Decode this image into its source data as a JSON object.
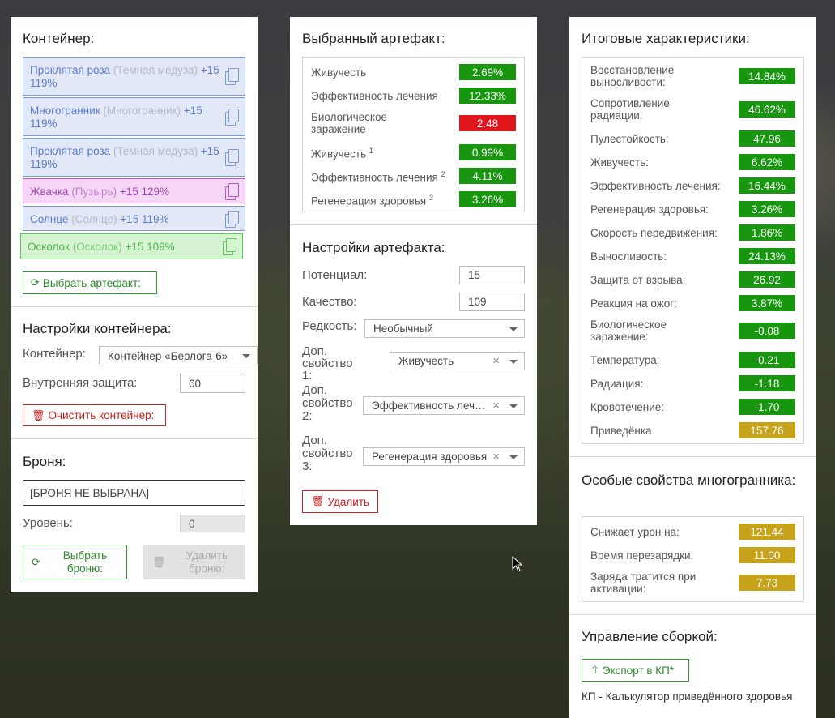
{
  "container": {
    "heading": "Контейнер:",
    "items": [
      {
        "name": "Проклятая роза",
        "sub": "(Темная медуза)",
        "level": "+15 119%"
      },
      {
        "name": "Многогранник",
        "sub": "(Многогранник)",
        "level": "+15 119%"
      },
      {
        "name": "Проклятая роза",
        "sub": "(Темная медуза)",
        "level": "+15 119%"
      },
      {
        "name": "Жвачка",
        "sub": "(Пузырь)",
        "level": "+15 129%"
      },
      {
        "name": "Солнце",
        "sub": "(Солнце)",
        "level": "+15 119%"
      },
      {
        "name": "Осколок",
        "sub": "(Осколок)",
        "level": "+15 109%"
      }
    ],
    "select_button": "Выбрать артефакт:"
  },
  "container_settings": {
    "heading": "Настройки контейнера:",
    "container_label": "Контейнер:",
    "container_value": "Контейнер «Берлога-6»",
    "protection_label": "Внутренняя защита:",
    "protection_value": "60",
    "clear_button": "Очистить контейнер:"
  },
  "armor": {
    "heading": "Броня:",
    "placeholder": "[БРОНЯ НЕ ВЫБРАНА]",
    "level_label": "Уровень:",
    "level_value": "0",
    "select_button": "Выбрать броню:",
    "delete_button": "Удалить броню:"
  },
  "selected_artifact": {
    "heading": "Выбранный артефакт:",
    "stats": [
      {
        "name": "Живучесть",
        "sup": "",
        "value": "2.69%",
        "color": "green"
      },
      {
        "name": "Эффективность лечения",
        "sup": "",
        "value": "12.33%",
        "color": "green"
      },
      {
        "name": "Биологическое заражение",
        "sup": "",
        "value": "2.48",
        "color": "red"
      },
      {
        "name": "Живучесть",
        "sup": "1",
        "value": "0.99%",
        "color": "green"
      },
      {
        "name": "Эффективность лечения",
        "sup": "2",
        "value": "4.11%",
        "color": "green"
      },
      {
        "name": "Регенерация здоровья",
        "sup": "3",
        "value": "3.26%",
        "color": "green"
      }
    ]
  },
  "artifact_settings": {
    "heading": "Настройки артефакта:",
    "potential_label": "Потенциал:",
    "potential_value": "15",
    "quality_label": "Качество:",
    "quality_value": "109",
    "rarity_label": "Редкость:",
    "rarity_value": "Необычный",
    "prop1_label": "Доп. свойство 1:",
    "prop1_value": "Живучесть",
    "prop2_label": "Доп. свойство 2:",
    "prop2_value": "Эффективность лечения",
    "prop3_label": "Доп. свойство 3:",
    "prop3_value": "Регенерация здоровья",
    "delete_button": "Удалить"
  },
  "totals": {
    "heading": "Итоговые характеристики:",
    "stats": [
      {
        "name": "Восстановление выносливости:",
        "value": "14.84%",
        "color": "green"
      },
      {
        "name": "Сопротивление радиации:",
        "value": "46.62%",
        "color": "green"
      },
      {
        "name": "Пулестойкость:",
        "value": "47.96",
        "color": "green"
      },
      {
        "name": "Живучесть:",
        "value": "6.62%",
        "color": "green"
      },
      {
        "name": "Эффективность лечения:",
        "value": "16.44%",
        "color": "green"
      },
      {
        "name": "Регенерация здоровья:",
        "value": "3.26%",
        "color": "green"
      },
      {
        "name": "Скорость передвижения:",
        "value": "1.86%",
        "color": "green"
      },
      {
        "name": "Выносливость:",
        "value": "24.13%",
        "color": "green"
      },
      {
        "name": "Защита от взрыва:",
        "value": "26.92",
        "color": "green"
      },
      {
        "name": "Реакция на ожог:",
        "value": "3.87%",
        "color": "green"
      },
      {
        "name": "Биологическое заражение:",
        "value": "-0.08",
        "color": "green"
      },
      {
        "name": "Температура:",
        "value": "-0.21",
        "color": "green"
      },
      {
        "name": "Радиация:",
        "value": "-1.18",
        "color": "green"
      },
      {
        "name": "Кровотечение:",
        "value": "-1.70",
        "color": "green"
      },
      {
        "name": "Приведёнка",
        "value": "157.76",
        "color": "gold"
      }
    ]
  },
  "polyhedron": {
    "heading": "Особые свойства многогранника:",
    "stats": [
      {
        "name": "Снижает урон на:",
        "value": "121.44",
        "color": "gold"
      },
      {
        "name": "Время перезарядки:",
        "value": "11.00",
        "color": "gold"
      },
      {
        "name": "Заряда тратится при активации:",
        "value": "7.73",
        "color": "gold"
      }
    ]
  },
  "build": {
    "heading": "Управление сборкой:",
    "export_button": "Экспорт в КП*",
    "note": "КП - Калькулятор приведённого здоровья"
  },
  "colors": {
    "green": "#18960f",
    "red": "#e0161c",
    "gold": "#c7a31c"
  }
}
